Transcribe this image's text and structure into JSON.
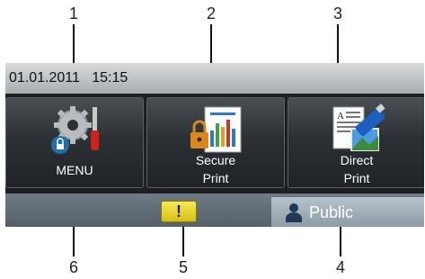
{
  "callouts": {
    "c1": "1",
    "c2": "2",
    "c3": "3",
    "c4": "4",
    "c5": "5",
    "c6": "6"
  },
  "status": {
    "datetime": "01.01.2011   15:15"
  },
  "tiles": {
    "menu": {
      "line1": "MENU",
      "icon": "gear-screwdriver-icon"
    },
    "secure_print": {
      "line1": "Secure",
      "line2": "Print",
      "icon": "secure-print-icon"
    },
    "direct_print": {
      "line1": "Direct",
      "line2": "Print",
      "icon": "usb-direct-print-icon"
    }
  },
  "bottom": {
    "warning": "!",
    "user_label": "Public",
    "user_icon": "person-icon"
  },
  "colors": {
    "warning": "#e8d82a",
    "tile": "#2c3034",
    "status_bar": "#c4c7c9",
    "user_bar": "#a1afb9"
  }
}
